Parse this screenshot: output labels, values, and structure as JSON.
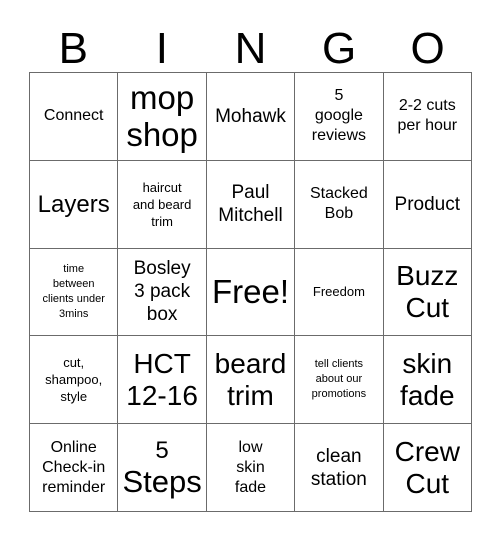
{
  "card": {
    "title": "BINGO",
    "header_letters": [
      "B",
      "I",
      "N",
      "G",
      "O"
    ],
    "grid_size": "5x5",
    "colors": {
      "background": "#ffffff",
      "text": "#000000",
      "border": "#6b6b6b"
    },
    "rows": [
      [
        {
          "text": "Connect",
          "size": "sm"
        },
        {
          "text": "mop\nshop",
          "size": "xxl"
        },
        {
          "text": "Mohawk",
          "size": "md"
        },
        {
          "text": "5\ngoogle\nreviews",
          "size": "sm"
        },
        {
          "text": "2-2 cuts\nper hour",
          "size": "sm"
        }
      ],
      [
        {
          "text": "Layers",
          "size": "lg"
        },
        {
          "text": "haircut\nand beard\ntrim",
          "size": "xs"
        },
        {
          "text": "Paul\nMitchell",
          "size": "md"
        },
        {
          "text": "Stacked\nBob",
          "size": "sm"
        },
        {
          "text": "Product",
          "size": "md"
        }
      ],
      [
        {
          "text": "time\nbetween\nclients under\n3mins",
          "size": "xxs"
        },
        {
          "text": "Bosley\n3 pack\nbox",
          "size": "md"
        },
        {
          "text": "Free!",
          "size": "xxl"
        },
        {
          "text": "Freedom",
          "size": "xs"
        },
        {
          "text": "Buzz\nCut",
          "size": "xl"
        }
      ],
      [
        {
          "text": "cut,\nshampoo,\nstyle",
          "size": "xs"
        },
        {
          "text": "HCT\n12-16",
          "size": "xl"
        },
        {
          "text": "beard\ntrim",
          "size": "xl"
        },
        {
          "text": "tell clients\nabout our\npromotions",
          "size": "xxs"
        },
        {
          "text": "skin\nfade",
          "size": "xl"
        }
      ],
      [
        {
          "text": "Online\nCheck-in\nreminder",
          "size": "sm"
        },
        {
          "text": "5\nSteps",
          "size": "mixed"
        },
        {
          "text": "low\nskin\nfade",
          "size": "sm"
        },
        {
          "text": "clean\nstation",
          "size": "md"
        },
        {
          "text": "Crew\nCut",
          "size": "xl"
        }
      ]
    ]
  }
}
